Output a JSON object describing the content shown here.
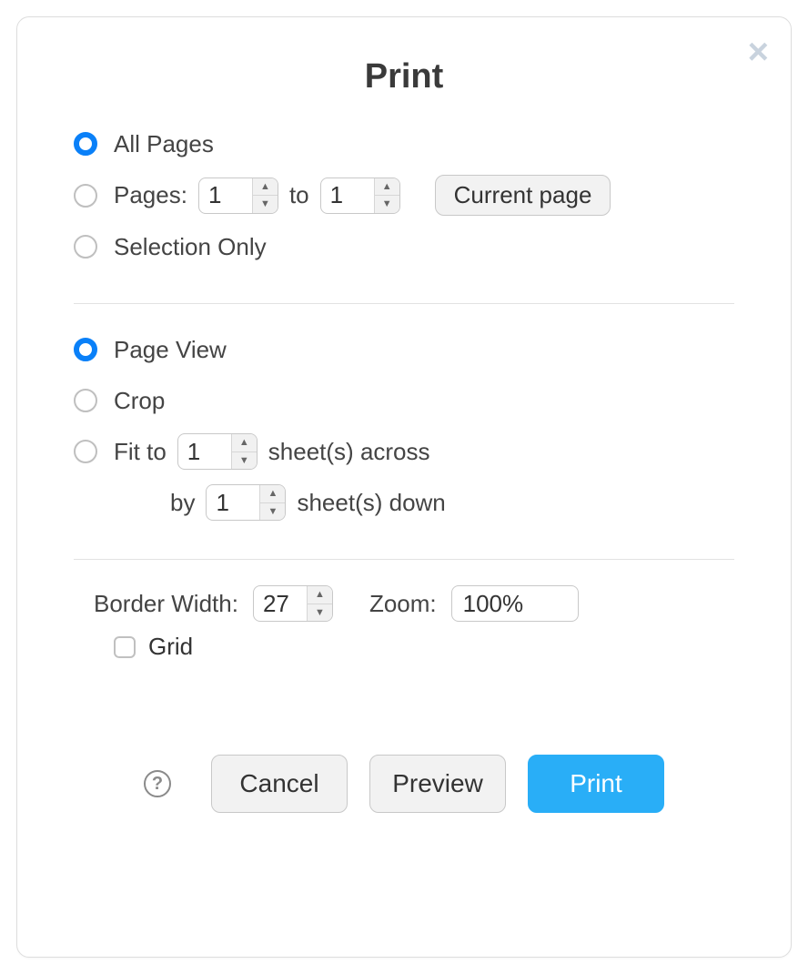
{
  "title": "Print",
  "range": {
    "all_pages_label": "All Pages",
    "pages_label": "Pages:",
    "pages_from": "1",
    "pages_to_word": "to",
    "pages_to": "1",
    "current_page_label": "Current page",
    "selection_only_label": "Selection Only",
    "selected": "all"
  },
  "view": {
    "page_view_label": "Page View",
    "crop_label": "Crop",
    "fit_to_label": "Fit to",
    "fit_across_value": "1",
    "sheets_across_label": "sheet(s) across",
    "fit_by_label": "by",
    "fit_down_value": "1",
    "sheets_down_label": "sheet(s) down",
    "selected": "page_view"
  },
  "settings": {
    "border_width_label": "Border Width:",
    "border_width_value": "27",
    "zoom_label": "Zoom:",
    "zoom_value": "100%",
    "grid_label": "Grid",
    "grid_checked": false
  },
  "footer": {
    "help_glyph": "?",
    "cancel_label": "Cancel",
    "preview_label": "Preview",
    "print_label": "Print"
  },
  "colors": {
    "accent": "#29aef7",
    "radio_selected": "#0a80f8"
  }
}
